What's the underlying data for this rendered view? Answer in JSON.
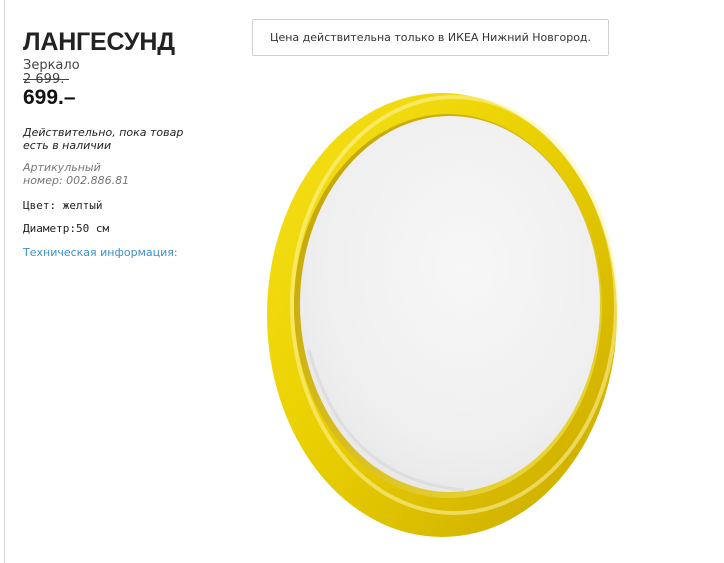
{
  "product": {
    "name": "ЛАНГЕСУНД",
    "type": "Зеркало",
    "old_price": "2 699.-",
    "price": "699.–",
    "validity": "Действительно, пока товар есть в наличии",
    "article_label": "Артикульный",
    "article_number": "номер: 002.886.81",
    "color": "Цвет: желтый",
    "diameter": "Диаметр:50 см",
    "tech_info_link": "Техническая информация:"
  },
  "notice": {
    "text": "Цена действительна только в ИКЕА Нижний Новгород."
  },
  "image": {
    "icon": "round-yellow-mirror-photo",
    "frame_color": "#e8c900",
    "glass_color": "#f2f2f2"
  }
}
